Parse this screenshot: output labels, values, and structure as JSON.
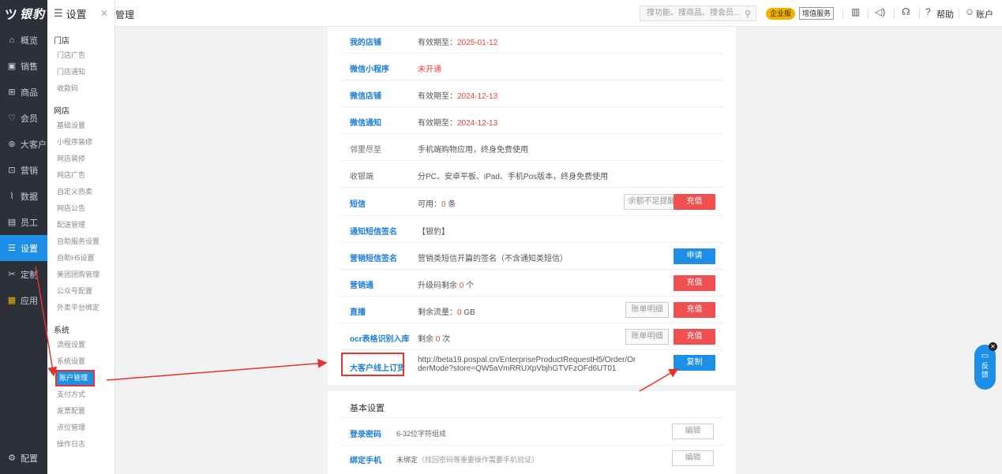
{
  "rail": {
    "logo": "银豹",
    "items": [
      {
        "label": "概览"
      },
      {
        "label": "销售"
      },
      {
        "label": "商品"
      },
      {
        "label": "会员"
      },
      {
        "label": "大客户"
      },
      {
        "label": "营销"
      },
      {
        "label": "数据"
      },
      {
        "label": "员工"
      },
      {
        "label": "设置"
      },
      {
        "label": "定制"
      },
      {
        "label": "应用"
      }
    ],
    "bottom": "配置"
  },
  "side": {
    "title": "设置",
    "groups": [
      {
        "title": "门店",
        "links": [
          "门店广告",
          "门店通知",
          "收款码"
        ]
      },
      {
        "title": "网店",
        "links": [
          "基础设置",
          "小程序装修",
          "网店装修",
          "网店广告",
          "自定义热卖",
          "网店公告",
          "配送管理",
          "自助服务设置",
          "自助H5设置",
          "美团团购管理",
          "公众号配置",
          "外卖平台绑定"
        ]
      },
      {
        "title": "系统",
        "links": [
          "流程设置",
          "系统设置",
          "账户管理",
          "支付方式",
          "发票配置",
          "点位管理",
          "操作日志"
        ]
      }
    ]
  },
  "topbar": {
    "title": "管理",
    "search_placeholder": "搜功能、搜商品、搜会员...",
    "badge_enterprise": "企业版",
    "badge_vas": "增值服务",
    "help": "帮助",
    "account": "账户"
  },
  "rows": [
    {
      "label": "我的店铺",
      "prefix": "有效期至：",
      "value": "2025-01-12"
    },
    {
      "label": "微信小程序",
      "prefix": "",
      "value": "未开通"
    },
    {
      "label": "微信店铺",
      "prefix": "有效期至：",
      "value": "2024-12-13"
    },
    {
      "label": "微信通知",
      "prefix": "有效期至：",
      "value": "2024-12-13"
    },
    {
      "label": "邻里尽至",
      "text": "手机端购物应用，终身免费使用"
    },
    {
      "label": "收银端",
      "text": "分PC、安卓平板、iPad、手机Pos版本，终身免费使用"
    },
    {
      "label": "短信",
      "prefix": "可用：",
      "value": "0",
      "suffix": " 条",
      "btn_ghost": "余额不足提醒",
      "btn": "充值"
    },
    {
      "label": "通知短信签名",
      "text": "【银豹】"
    },
    {
      "label": "营销短信签名",
      "text": "营销类短信开篇的签名（不含通知类短信）",
      "btn_blue": "申请"
    },
    {
      "label": "营销通",
      "prefix": "升级码剩余 ",
      "value": "0",
      "suffix": " 个",
      "btn": "充值"
    },
    {
      "label": "直播",
      "prefix": "剩余流量：",
      "value": "0",
      "suffix": " GB",
      "btn_ghost": "账单明细",
      "btn": "充值"
    },
    {
      "label": "ocr表格识别入库",
      "prefix": "剩余 ",
      "value": "0",
      "suffix": " 次",
      "btn_ghost": "账单明细",
      "btn": "充值"
    },
    {
      "label": "大客户线上订货",
      "url": "http://beta19.pospal.cn/EnterpriseProductRequestH5/Order/OrderMode?store=QW5aVmRRUXpVbjhGTVFzOFd6UT01",
      "btn_blue": "复制"
    }
  ],
  "basic": {
    "title": "基本设置",
    "password_label": "登录密码",
    "password_desc": "6-32位字符组成",
    "phone_label": "绑定手机",
    "phone_desc": "未绑定",
    "phone_sub": "（找回密码等重要操作需要手机验证）",
    "edit": "编辑"
  },
  "feedback": "反馈"
}
